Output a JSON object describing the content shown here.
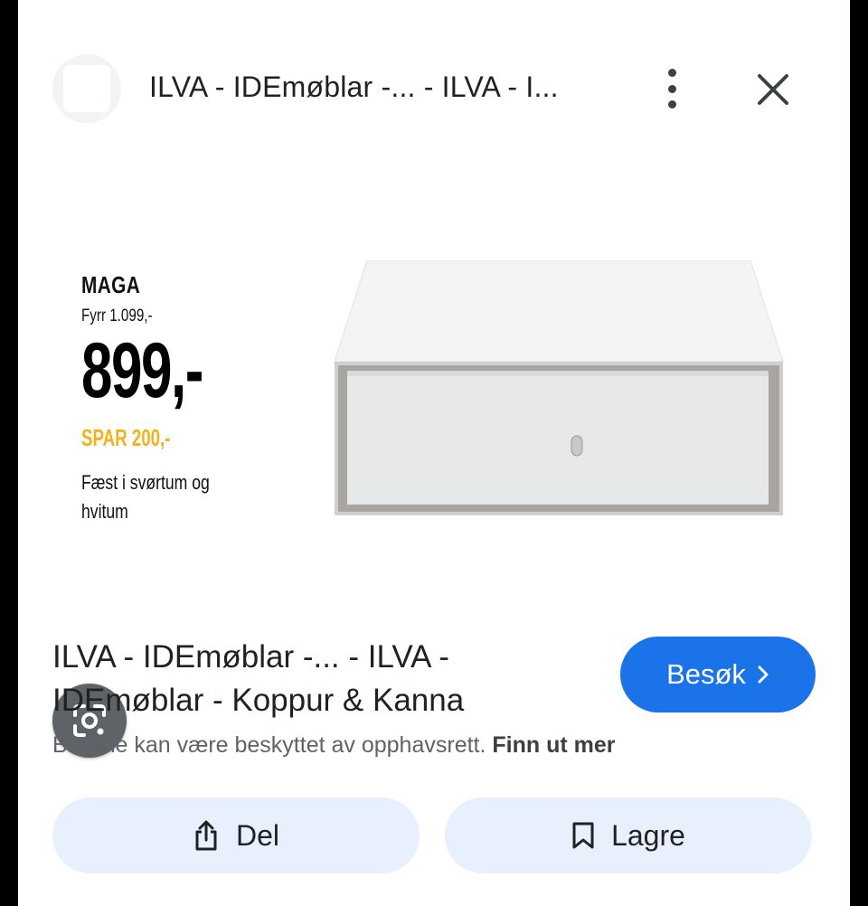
{
  "header": {
    "title": "ILVA - IDEmøblar -... - ILVA - I...",
    "more_icon": "more-vert-icon",
    "close_icon": "close-icon"
  },
  "image": {
    "ad": {
      "brand": "MAGA",
      "old_price": "Fyrr 1.099,-",
      "price": "899,-",
      "savings": "SPAR 200,-",
      "colors": "Fæst i svørtum og hvitum"
    },
    "lens_icon": "google-lens-icon"
  },
  "result": {
    "title": "ILVA - IDEmøblar -... - ILVA - IDEmøblar - Koppur & Kanna",
    "visit_label": "Besøk",
    "copyright_text": "Bildene kan være beskyttet av opphavsrett.",
    "learn_more": "Finn ut mer"
  },
  "actions": {
    "share_label": "Del",
    "save_label": "Lagre"
  },
  "colors": {
    "accent": "#1a73e8",
    "button_bg": "#e8f0fe",
    "savings": "#f5b11a"
  }
}
